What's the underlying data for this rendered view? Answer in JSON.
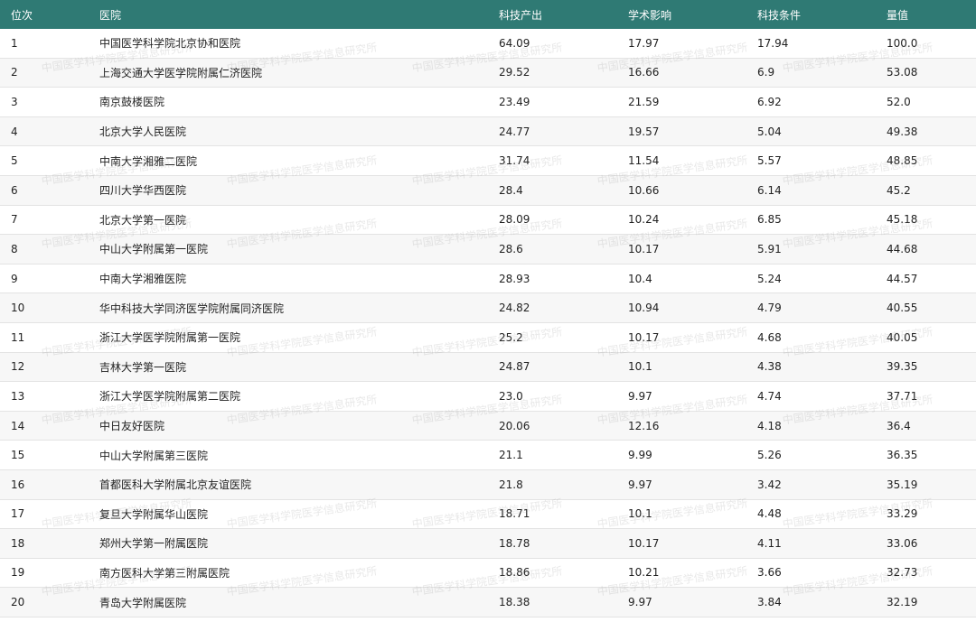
{
  "header": [
    "位次",
    "医院",
    "科技产出",
    "学术影响",
    "科技条件",
    "量值"
  ],
  "rows": [
    [
      "1",
      "中国医学科学院北京协和医院",
      "64.09",
      "17.97",
      "17.94",
      "100.0"
    ],
    [
      "2",
      "上海交通大学医学院附属仁济医院",
      "29.52",
      "16.66",
      "6.9",
      "53.08"
    ],
    [
      "3",
      "南京鼓楼医院",
      "23.49",
      "21.59",
      "6.92",
      "52.0"
    ],
    [
      "4",
      "北京大学人民医院",
      "24.77",
      "19.57",
      "5.04",
      "49.38"
    ],
    [
      "5",
      "中南大学湘雅二医院",
      "31.74",
      "11.54",
      "5.57",
      "48.85"
    ],
    [
      "6",
      "四川大学华西医院",
      "28.4",
      "10.66",
      "6.14",
      "45.2"
    ],
    [
      "7",
      "北京大学第一医院",
      "28.09",
      "10.24",
      "6.85",
      "45.18"
    ],
    [
      "8",
      "中山大学附属第一医院",
      "28.6",
      "10.17",
      "5.91",
      "44.68"
    ],
    [
      "9",
      "中南大学湘雅医院",
      "28.93",
      "10.4",
      "5.24",
      "44.57"
    ],
    [
      "10",
      "华中科技大学同济医学院附属同济医院",
      "24.82",
      "10.94",
      "4.79",
      "40.55"
    ],
    [
      "11",
      "浙江大学医学院附属第一医院",
      "25.2",
      "10.17",
      "4.68",
      "40.05"
    ],
    [
      "12",
      "吉林大学第一医院",
      "24.87",
      "10.1",
      "4.38",
      "39.35"
    ],
    [
      "13",
      "浙江大学医学院附属第二医院",
      "23.0",
      "9.97",
      "4.74",
      "37.71"
    ],
    [
      "14",
      "中日友好医院",
      "20.06",
      "12.16",
      "4.18",
      "36.4"
    ],
    [
      "15",
      "中山大学附属第三医院",
      "21.1",
      "9.99",
      "5.26",
      "36.35"
    ],
    [
      "16",
      "首都医科大学附属北京友谊医院",
      "21.8",
      "9.97",
      "3.42",
      "35.19"
    ],
    [
      "17",
      "复旦大学附属华山医院",
      "18.71",
      "10.1",
      "4.48",
      "33.29"
    ],
    [
      "18",
      "郑州大学第一附属医院",
      "18.78",
      "10.17",
      "4.11",
      "33.06"
    ],
    [
      "19",
      "南方医科大学第三附属医院",
      "18.86",
      "10.21",
      "3.66",
      "32.73"
    ],
    [
      "20",
      "青岛大学附属医院",
      "18.38",
      "9.97",
      "3.84",
      "32.19"
    ]
  ],
  "watermark": "中国医学科学院医学信息研究所",
  "colors": {
    "header_bg": "#2f7a74",
    "header_text": "#ffffff",
    "row_alt": "#f7f7f7"
  }
}
